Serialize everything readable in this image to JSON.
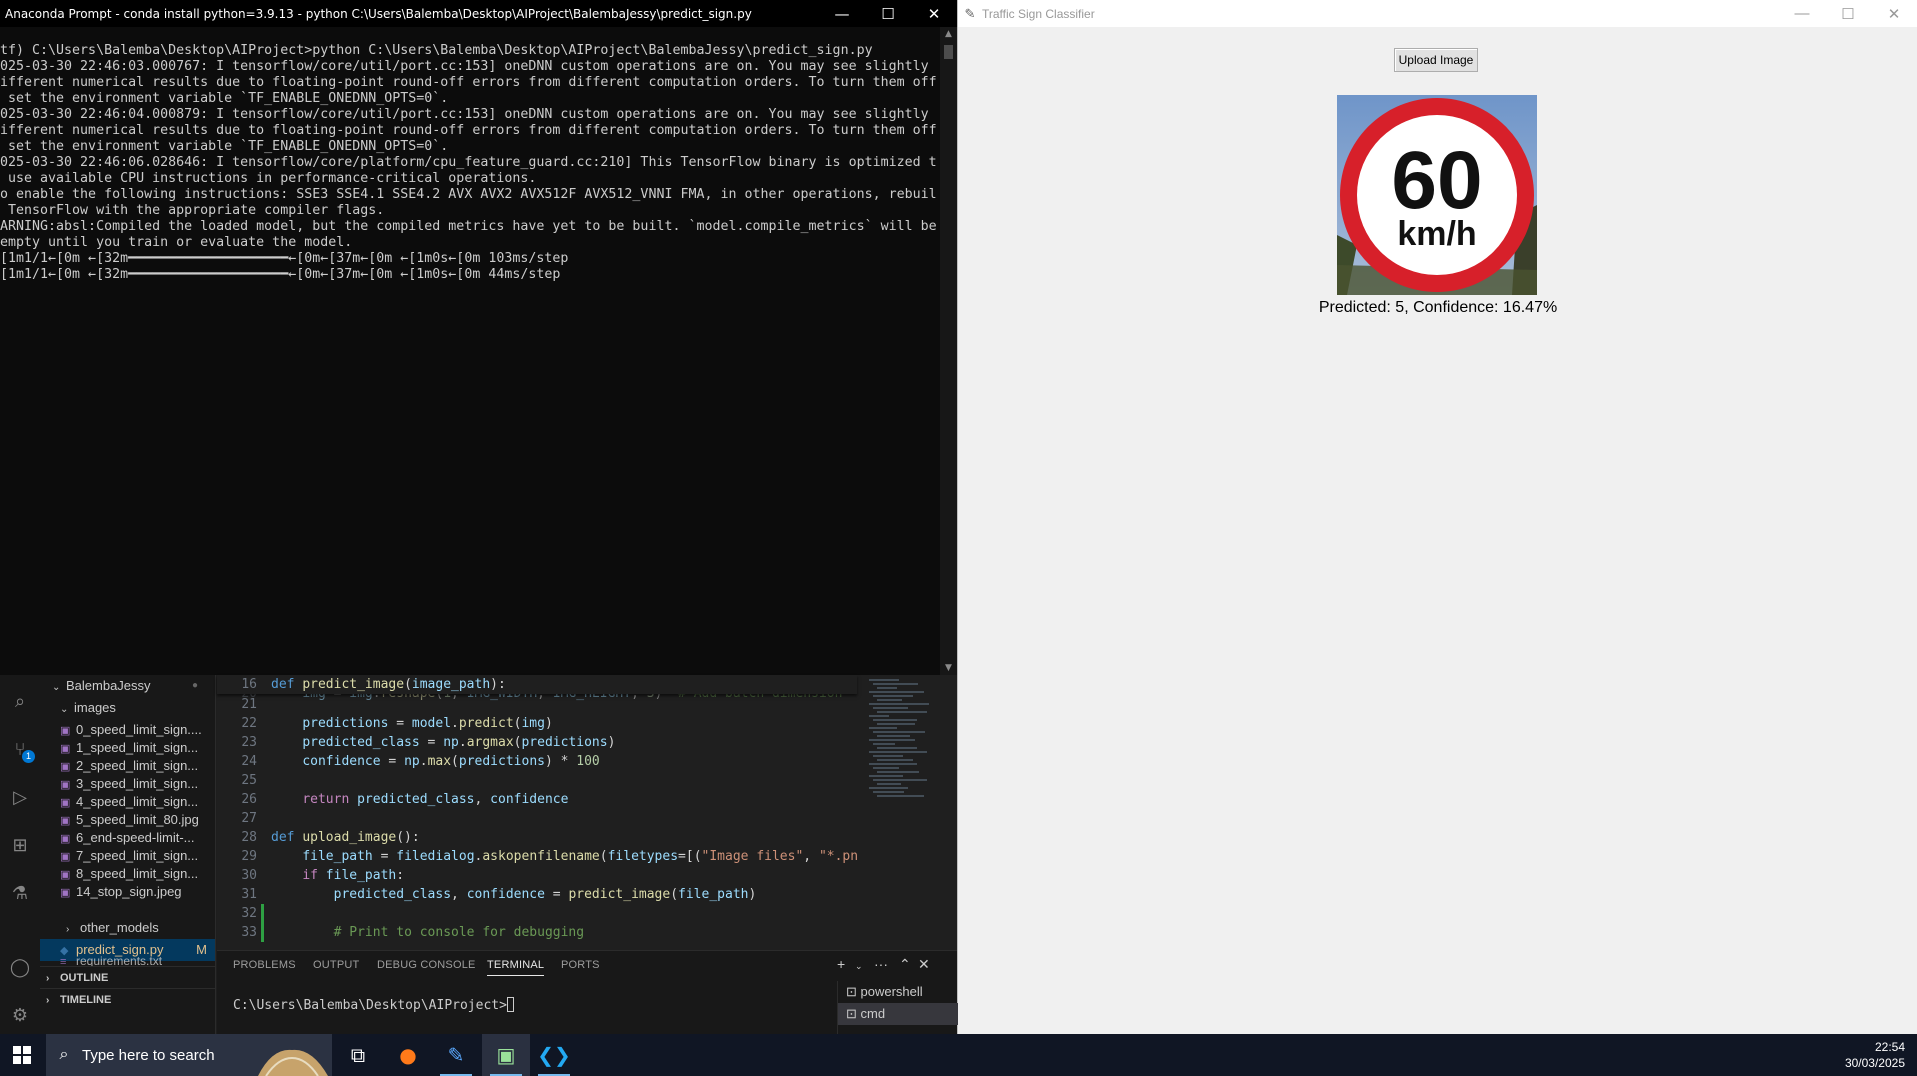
{
  "console": {
    "title": "Anaconda Prompt - conda  install python=3.9.13 - python  C:\\Users\\Balemba\\Desktop\\AIProject\\BalembaJessy\\predict_sign.py",
    "lines": [
      "tf) C:\\Users\\Balemba\\Desktop\\AIProject>python C:\\Users\\Balemba\\Desktop\\AIProject\\BalembaJessy\\predict_sign.py",
      "025-03-30 22:46:03.000767: I tensorflow/core/util/port.cc:153] oneDNN custom operations are on. You may see slightly",
      "ifferent numerical results due to floating-point round-off errors from different computation orders. To turn them off",
      " set the environment variable `TF_ENABLE_ONEDNN_OPTS=0`.",
      "025-03-30 22:46:04.000879: I tensorflow/core/util/port.cc:153] oneDNN custom operations are on. You may see slightly",
      "ifferent numerical results due to floating-point round-off errors from different computation orders. To turn them off",
      " set the environment variable `TF_ENABLE_ONEDNN_OPTS=0`.",
      "025-03-30 22:46:06.028646: I tensorflow/core/platform/cpu_feature_guard.cc:210] This TensorFlow binary is optimized t",
      " use available CPU instructions in performance-critical operations.",
      "o enable the following instructions: SSE3 SSE4.1 SSE4.2 AVX AVX2 AVX512F AVX512_VNNI FMA, in other operations, rebuil",
      " TensorFlow with the appropriate compiler flags.",
      "ARNING:absl:Compiled the loaded model, but the compiled metrics have yet to be built. `model.compile_metrics` will be",
      "empty until you train or evaluate the model.",
      "[1m1/1←[0m ←[32m━━━━━━━━━━━━━━━━━━━━←[0m←[37m←[0m ←[1m0s←[0m 103ms/step",
      "[1m1/1←[0m ←[32m━━━━━━━━━━━━━━━━━━━━←[0m←[37m←[0m ←[1m0s←[0m 44ms/step"
    ]
  },
  "tk": {
    "title": "Traffic Sign Classifier",
    "upload_label": "Upload Image",
    "sign_number": "60",
    "sign_unit": "km/h",
    "prediction": "Predicted: 5, Confidence: 16.47%"
  },
  "vscode": {
    "badge": "1",
    "explorer": {
      "root": "BalembaJessy",
      "folder": "images",
      "files": [
        "0_speed_limit_sign....",
        "1_speed_limit_sign...",
        "2_speed_limit_sign...",
        "3_speed_limit_sign...",
        "4_speed_limit_sign...",
        "5_speed_limit_80.jpg",
        "6_end-speed-limit-...",
        "7_speed_limit_sign...",
        "8_speed_limit_sign...",
        "14_stop_sign.jpeg"
      ],
      "other_folder": "other_models",
      "active_file": "predict_sign.py",
      "active_status": "M",
      "partial_file": "requirements.txt",
      "outline": "OUTLINE",
      "timeline": "TIMELINE"
    },
    "panel": {
      "tabs": [
        "PROBLEMS",
        "OUTPUT",
        "DEBUG CONSOLE",
        "TERMINAL",
        "PORTS"
      ],
      "prompt": "C:\\Users\\Balemba\\Desktop\\AIProject>",
      "terminals": [
        "powershell",
        "cmd"
      ]
    }
  },
  "taskbar": {
    "search_placeholder": "Type here to search",
    "time": "22:54",
    "date": "30/03/2025"
  }
}
